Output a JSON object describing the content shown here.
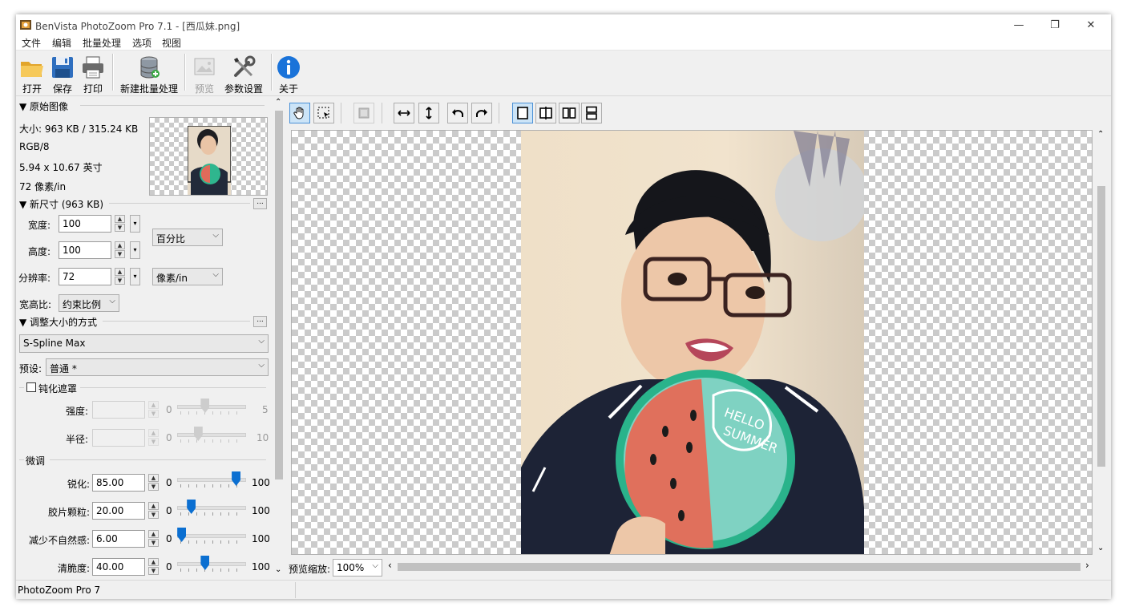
{
  "window": {
    "title": "BenVista PhotoZoom Pro 7.1 - [西瓜妹.png]",
    "controls": {
      "minimize": "—",
      "maximize": "❐",
      "close": "✕"
    }
  },
  "menu": [
    "文件",
    "编辑",
    "批量处理",
    "选项",
    "视图"
  ],
  "toolbar": {
    "open": "打开",
    "save": "保存",
    "print": "打印",
    "new_batch": "新建批量处理",
    "preview": "预览",
    "settings": "参数设置",
    "about": "关于"
  },
  "original": {
    "header": "▼ 原始图像",
    "size": "大小: 963 KB / 315.24 KB",
    "mode": "RGB/8",
    "dimensions": "5.94 x 10.67 英寸",
    "resolution": "72 像素/in"
  },
  "new_size": {
    "header": "▼ 新尺寸 (963 KB)",
    "more": "...",
    "width_label": "宽度:",
    "width_value": "100",
    "height_label": "高度:",
    "height_value": "100",
    "unit": "百分比",
    "res_label": "分辨率:",
    "res_value": "72",
    "res_unit": "像素/in",
    "aspect_label": "宽高比:",
    "aspect_value": "约束比例"
  },
  "resize_method": {
    "header": "▼ 调整大小的方式",
    "more": "...",
    "method": "S-Spline Max",
    "preset_label": "预设:",
    "preset_value": "普通 *"
  },
  "unsharp": {
    "checkbox_label": "钝化遮罩",
    "checked": false,
    "strength_label": "强度:",
    "strength_min": "0",
    "strength_max": "5",
    "strength_level": 0.4,
    "radius_label": "半径:",
    "radius_min": "0",
    "radius_max": "10",
    "radius_level": 0.3
  },
  "finetune": {
    "header": "微调",
    "rows": [
      {
        "label": "锐化:",
        "value": "85.00",
        "min": "0",
        "max": "100",
        "level": 0.85
      },
      {
        "label": "胶片颗粒:",
        "value": "20.00",
        "min": "0",
        "max": "100",
        "level": 0.2
      },
      {
        "label": "减少不自然感:",
        "value": "6.00",
        "min": "0",
        "max": "100",
        "level": 0.06
      },
      {
        "label": "清脆度:",
        "value": "40.00",
        "min": "0",
        "max": "100",
        "level": 0.4
      }
    ]
  },
  "preview": {
    "zoom_label": "预览缩放:",
    "zoom_value": "100%"
  },
  "status": {
    "text": "PhotoZoom Pro 7"
  },
  "colors": {
    "accent": "#0b6fd1",
    "about_icon": "#1a73d9",
    "toggle_active": "#cce4f7"
  }
}
